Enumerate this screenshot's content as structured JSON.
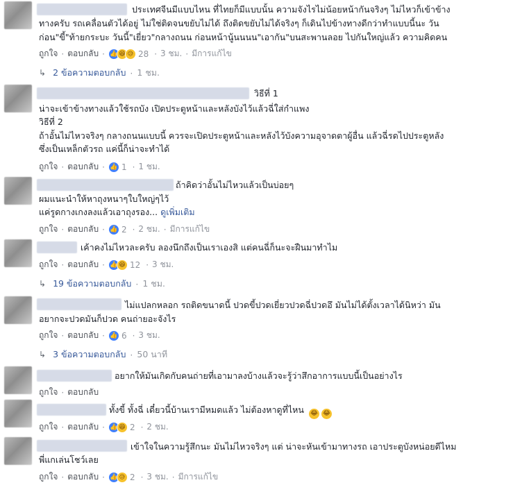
{
  "comments": [
    {
      "lines": [
        "ประเทศจีนมีแบบไหน ที่ไทยก็มีแบบนั้น ความจังไรไม่น้อยหน้ากันจริงๆ ไม่ไหวก็เข้าข้าง",
        "ทางครับ รถเคลื่อนตัวได้อยู่ ไม่ใช่ติดจนขยับไม่ได้ ถึงติดขยับไม่ได้จริงๆ ก็เดินไปข้างทางดีกว่าทำแบบนี้นะ วัน",
        "ก่อน\"ขี้\"ท้ายกระบะ วันนี้\"เยี่ยว\"กลางถนน ก่อนหน้านู้นนนน\"เอากัน\"บนสะพานลอย ไปกันใหญ่แล้ว ความคิดคน"
      ],
      "like": "ถูกใจ",
      "reply": "ตอบกลับ",
      "count": "28",
      "time": "3 ชม.",
      "edited": "มีการแก้ไข",
      "replies_label": "2 ข้อความตอบกลับ",
      "replies_time": "1 ชม."
    },
    {
      "lines": [
        "วิธีที่ 1",
        "น่าจะเข้าข้างทางแล้วใช้รถบัง เปิดประตูหน้าและหลังบังไว้แล้วฉี่ใส่กำแพง",
        "วิธีที่ 2",
        "ถ้าอั้นไม่ไหวจริงๆ กลางถนนแบบนี้ ควรจะเปิดประตูหน้าและหลังไว้บังความอุจาดตาผู้อื่น แล้วฉี่รดไปประตูหลัง",
        "ซึ่งเป็นเหล็กตัวรถ แค่นี้ก็น่าจะทำได้"
      ],
      "like": "ถูกใจ",
      "reply": "ตอบกลับ",
      "count": "1",
      "time": "1 ชม."
    },
    {
      "lines": [
        "ถ้าคิดว่าอั้นไม่ไหวแล้วเป็นบ่อยๆ",
        "ผมแนะนำให้หาถุงหนาๆใบใหญ่ๆไว้",
        "แค่รูดกางเกงลงแล้วเอาถุงรอง..."
      ],
      "see_more": "ดูเพิ่มเติม",
      "like": "ถูกใจ",
      "reply": "ตอบกลับ",
      "count": "2",
      "time": "2 ชม.",
      "edited": "มีการแก้ไข"
    },
    {
      "lines": [
        "เค้าคงไม่ไหวละครับ ลองนึกถึงเป็นเราเองสิ แต่คนฉี่ก็นะจะฝืนมาทำไม"
      ],
      "like": "ถูกใจ",
      "reply": "ตอบกลับ",
      "count": "12",
      "time": "3 ชม.",
      "replies_label": "19 ข้อความตอบกลับ",
      "replies_time": "1 ชม."
    },
    {
      "lines": [
        "ไม่แปลกหลอก รถติดขนาดนี้ ปวดขี้ปวดเยี่ยวปวดฉี่ปวดอึ มันไม่ได้ตั้งเวลาได้นิหว่า มัน",
        "อยากจะปวดมันก็ปวด คนถ่ายอะจังไร"
      ],
      "like": "ถูกใจ",
      "reply": "ตอบกลับ",
      "count": "6",
      "time": "3 ชม.",
      "replies_label": "3 ข้อความตอบกลับ",
      "replies_time": "50 นาที"
    },
    {
      "lines": [
        "อยากให้มันเกิดกับคนถ่ายที่เอามาลงบ้างแล้วจะรู้ว่าสึกอาการแบบนี้เป็นอย่างไร"
      ],
      "like": "ถูกใจ",
      "reply": "ตอบกลับ"
    },
    {
      "lines": [
        "ทั้งขี้ ทั้งฉี่ เดี๋ยวนี้บ้านเรามีหมดแล้ว ไม่ต้องหาดูที่ไหน"
      ],
      "like": "ถูกใจ",
      "reply": "ตอบกลับ",
      "count": "2",
      "time": "2 ชม."
    },
    {
      "lines": [
        "เข้าใจในความรู้สึกนะ มันไม่ไหวจริงๆ แต่ น่าจะหันเข้ามาทางรถ เอาประตูบังหน่อยดีไหม",
        "พี่แกเล่นโชว์เลย"
      ],
      "like": "ถูกใจ",
      "reply": "ตอบกลับ",
      "count": "2",
      "time": "3 ชม.",
      "edited": "มีการแก้ไข"
    }
  ],
  "colors": {
    "link": "#365899",
    "meta": "#90949c",
    "like_blue": "#4080ff",
    "haha_yellow": "#f7c22c"
  },
  "icons": [
    "like-reaction-icon",
    "haha-reaction-icon",
    "sad-reaction-icon",
    "reply-arrow-icon",
    "laughing-emoji-icon"
  ]
}
